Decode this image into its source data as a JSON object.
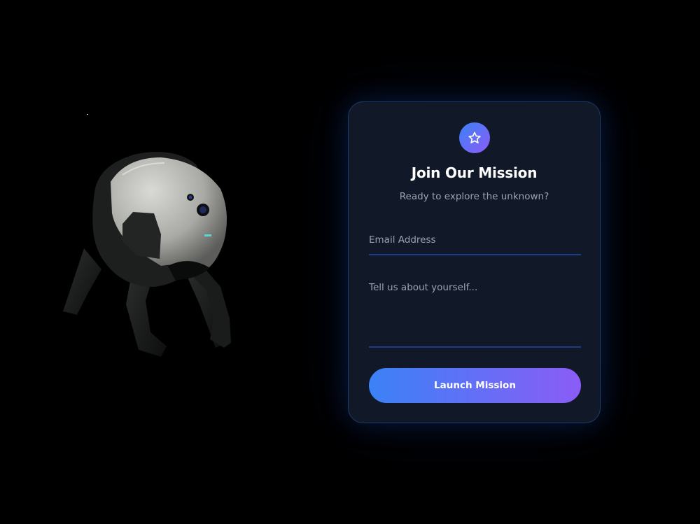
{
  "card": {
    "icon": "star-icon",
    "title": "Join Our Mission",
    "subtitle": "Ready to explore the unknown?",
    "email_placeholder": "Email Address",
    "about_placeholder": "Tell us about yourself...",
    "submit_label": "Launch Mission"
  },
  "scene": {
    "illustration": "spherical-robot"
  },
  "colors": {
    "background": "#000000",
    "card_background": "#111827",
    "card_border": "#1f3a68",
    "accent_start": "#3b82f6",
    "accent_end": "#8b5cf6",
    "muted_text": "#9ca3af",
    "field_underline": "#1e3a8a"
  }
}
